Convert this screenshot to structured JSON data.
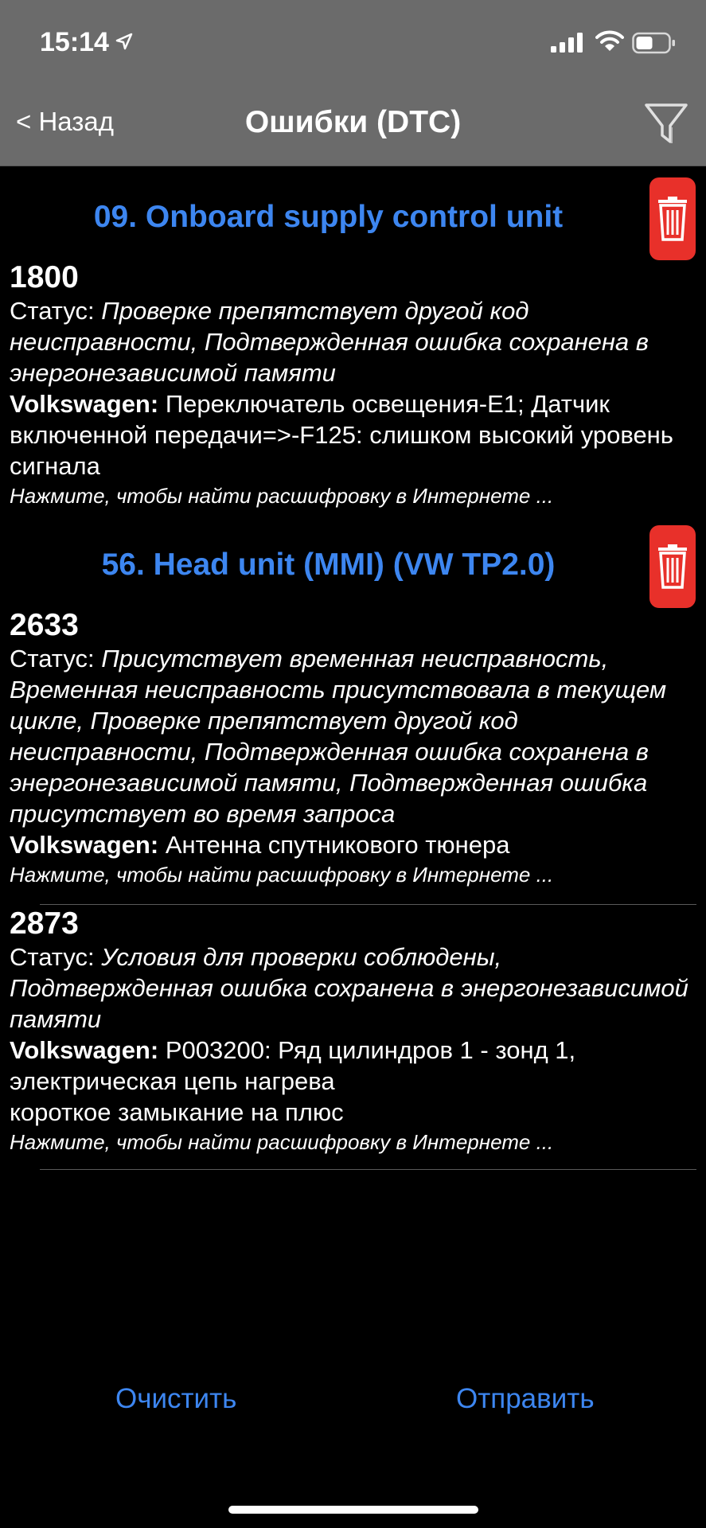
{
  "status_bar": {
    "time": "15:14"
  },
  "nav": {
    "back_label": "< Назад",
    "title": "Ошибки (DTC)"
  },
  "modules": [
    {
      "title": "09. Onboard supply control unit",
      "dtcs": [
        {
          "code": "1800",
          "status_label": "Статус:",
          "status": "Проверке препятствует другой код неисправности, Подтвержденная ошибка сохранена в энергонезависимой памяти",
          "make_label": "Volkswagen:",
          "description": "Переключатель освещения-E1; Датчик включенной передачи=>-F125: слишком высокий уровень сигнала",
          "hint": "Нажмите, чтобы найти расшифровку в Интернете ..."
        }
      ]
    },
    {
      "title": "56. Head unit (MMI) (VW TP2.0)",
      "dtcs": [
        {
          "code": "2633",
          "status_label": "Статус:",
          "status": "Присутствует временная неисправность, Временная неисправность присутствовала в текущем цикле, Проверке препятствует другой код неисправности, Подтвержденная ошибка сохранена в энергонезависимой памяти, Подтвержденная ошибка присутствует во время запроса",
          "make_label": "Volkswagen:",
          "description": "Антенна спутникового тюнера",
          "hint": "Нажмите, чтобы найти расшифровку в Интернете ..."
        },
        {
          "code": "2873",
          "status_label": "Статус:",
          "status": "Условия для проверки соблюдены, Подтвержденная ошибка сохранена в энергонезависимой памяти",
          "make_label": "Volkswagen:",
          "description": "P003200: Ряд цилиндров 1 - зонд 1, электрическая цепь нагрева",
          "description_extra": "короткое замыкание на плюс",
          "hint": "Нажмите, чтобы найти расшифровку в Интернете ..."
        }
      ]
    }
  ],
  "footer": {
    "clear_label": "Очистить",
    "send_label": "Отправить"
  },
  "colors": {
    "accent": "#3d86f0",
    "bar": "#6b6b6b",
    "delete": "#e8302a"
  },
  "icons": [
    "location-arrow-icon",
    "signal-icon",
    "wifi-icon",
    "battery-icon",
    "filter-icon",
    "trash-icon"
  ]
}
